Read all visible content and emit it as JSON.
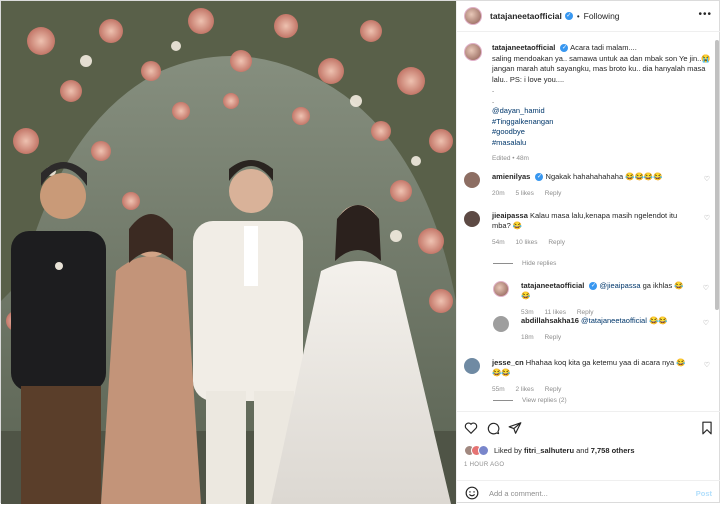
{
  "header": {
    "username": "tatajaneetaofficial",
    "follow_status": "Following",
    "separator": "•"
  },
  "caption": {
    "username": "tatajaneetaofficial",
    "text1": "Acara tadi malam....",
    "text2": "saling mendoakan ya.. samawa untuk aa dan mbak son Ye jin..",
    "text3": "jangan marah atuh sayangku, mas broto ku.. dia hanyalah masa lalu.. PS: i love you....",
    "text4": ".",
    "text5": ".",
    "tags": [
      "@dayan_hamid",
      "#Tinggalkenangan",
      "#goodbye",
      "#masalalu"
    ],
    "edited": "Edited",
    "age": "48m"
  },
  "comments": [
    {
      "username": "amienilyas",
      "text": "Ngakak hahahahahaha",
      "emoji": "😂😂😂😂",
      "time": "20m",
      "likes": "5 likes",
      "reply": "Reply"
    },
    {
      "username": "jieaipassa",
      "text": "Kalau masa lalu,kenapa masih ngelendot itu mba?",
      "emoji": "😂",
      "time": "54m",
      "likes": "10 likes",
      "reply": "Reply"
    },
    {
      "username": "tatajaneetaofficial",
      "mention": "@jieaipassa",
      "text": "ga ikhlas",
      "emoji": "😂😂",
      "time": "53m",
      "likes": "11 likes",
      "reply": "Reply"
    },
    {
      "username": "abdillahsakha16",
      "mention": "@tatajaneetaofficial",
      "text": "",
      "emoji": "😂😂",
      "time": "18m",
      "reply": "Reply"
    },
    {
      "username": "jesse_cn",
      "text": "Hhahaa koq kita ga ketemu yaa di acara nya",
      "emoji": "😂😂😂",
      "time": "55m",
      "likes": "2 likes",
      "reply": "Reply"
    }
  ],
  "hide_replies": "Hide replies",
  "view_replies": "View replies (2)",
  "likes": {
    "text_prefix": "Liked by",
    "user": "fitri_salhuteru",
    "and": "and",
    "count": "7,758 others"
  },
  "time_ago": "1 HOUR AGO",
  "add_comment": {
    "placeholder": "Add a comment...",
    "post": "Post"
  },
  "icons": {
    "like": "heart-icon",
    "comment": "comment-icon",
    "share": "share-icon",
    "save": "bookmark-icon",
    "more": "more-icon",
    "verified": "verified-badge-icon",
    "emoji": "emoji-icon"
  },
  "colors": {
    "link": "#00376b",
    "muted": "#8e8e8e",
    "verified": "#3897f0",
    "post": "#b2dffc"
  }
}
